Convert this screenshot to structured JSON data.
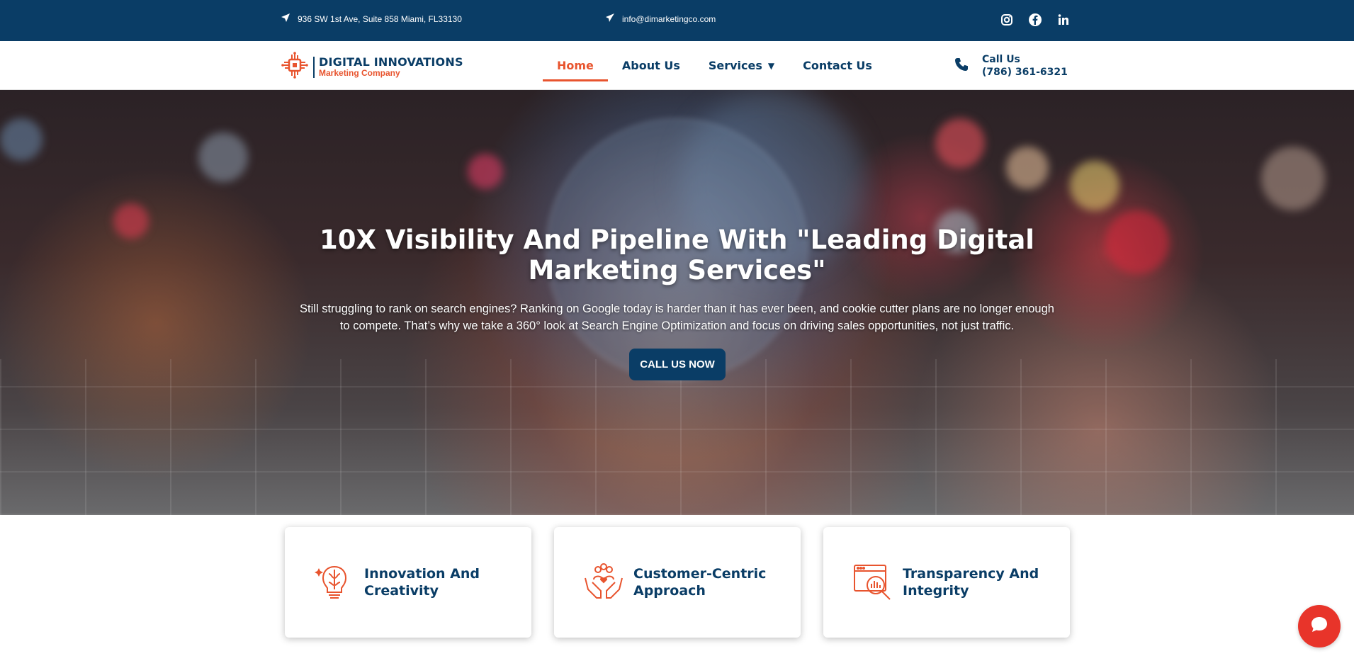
{
  "topbar": {
    "address": "936 SW 1st Ave, Suite 858 Miami, FL33130",
    "email": "info@dimarketingco.com",
    "social": [
      "instagram-icon",
      "facebook-icon",
      "linkedin-icon"
    ],
    "bg_color": "#0a3d66"
  },
  "header": {
    "logo_line1": "DIGITAL INNOVATIONS",
    "logo_line2": "Marketing Company",
    "nav": [
      {
        "label": "Home",
        "active": true
      },
      {
        "label": "About Us",
        "active": false
      },
      {
        "label": "Services",
        "active": false,
        "has_dropdown": true
      },
      {
        "label": "Contact Us",
        "active": false
      }
    ],
    "call_label": "Call Us",
    "call_number": "(786) 361-6321",
    "accent_color": "#e8542e"
  },
  "hero": {
    "title": "10X Visibility And Pipeline With \"Leading Digital Marketing Services\"",
    "subtitle": "Still struggling to rank on search engines? Ranking on Google today is harder than it has ever been, and cookie cutter plans are no longer enough to compete. That’s why we take a 360° look at Search Engine Optimization and focus on driving sales opportunities, not just traffic.",
    "cta_label": "CALL US NOW"
  },
  "features": [
    {
      "title": "Innovation And Creativity",
      "icon": "brain-bulb-icon"
    },
    {
      "title": "Customer-Centric Approach",
      "icon": "hands-people-icon"
    },
    {
      "title": "Transparency And Integrity",
      "icon": "analytics-magnifier-icon"
    }
  ],
  "chat": {
    "icon": "chat-icon",
    "color": "#e8342a"
  }
}
